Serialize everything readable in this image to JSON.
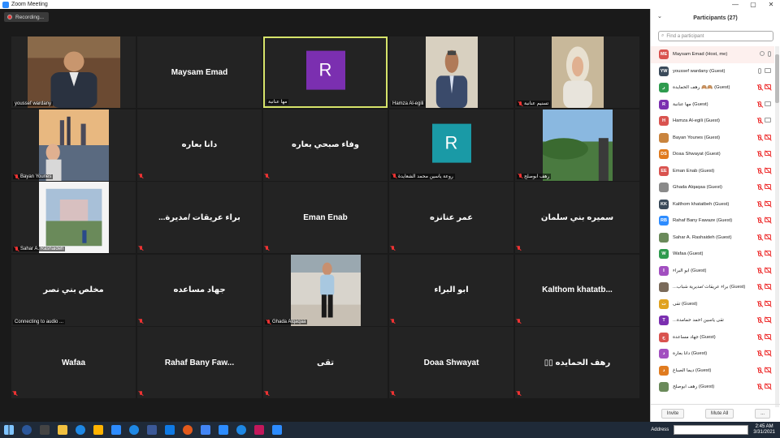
{
  "window": {
    "title": "Zoom Meeting",
    "controls": [
      "—",
      "▢",
      "✕"
    ]
  },
  "recording": {
    "label": "Recording..."
  },
  "tiles": [
    {
      "label": "youssef wardany",
      "kind": "photo",
      "photo": "man-office",
      "muted": false
    },
    {
      "label": "Maysam Emad",
      "kind": "name",
      "muted": false
    },
    {
      "label": "مها عنانبة",
      "kind": "avatar",
      "avatar_letter": "R",
      "avatar_color": "#7b2fb0",
      "active": true,
      "muted": false
    },
    {
      "label": "Hamza Al-egili",
      "kind": "photo",
      "photo": "man-suit",
      "muted": false
    },
    {
      "label": "تسنيم عنانبة",
      "kind": "photo",
      "photo": "woman-hijab",
      "muted": true
    },
    {
      "label": "Bayan Younes",
      "kind": "photo",
      "photo": "city-lake",
      "muted": true
    },
    {
      "label": "دانا بعاره",
      "kind": "name",
      "muted": true
    },
    {
      "label": "وفاء صبحي بعاره",
      "kind": "name",
      "muted": true
    },
    {
      "label": "روعة ياسين محمد الشعايدة",
      "kind": "avatar",
      "avatar_letter": "R",
      "avatar_color": "#1a9aa6",
      "muted": true
    },
    {
      "label": "رهف ابوصلح",
      "kind": "photo",
      "photo": "landscape",
      "muted": true
    },
    {
      "label": "Sahar A. Rashaideh",
      "kind": "photo",
      "photo": "castle",
      "muted": true
    },
    {
      "label": "...براء عريقات /مديرة",
      "kind": "name",
      "muted": true
    },
    {
      "label": "Eman Enab",
      "kind": "name",
      "muted": true
    },
    {
      "label": "عمر عنانزه",
      "kind": "name",
      "muted": true
    },
    {
      "label": "سميره بني سلمان",
      "kind": "name",
      "muted": true
    },
    {
      "label": "مخلص بني نصر",
      "kind": "name",
      "status": "Connecting to audio ...",
      "muted": false
    },
    {
      "label": "جهاد مساعده",
      "kind": "name",
      "muted": true
    },
    {
      "label": "Ghada Alqaqaa",
      "kind": "photo",
      "photo": "girl-stairs",
      "muted": true
    },
    {
      "label": "ابو البراء",
      "kind": "name",
      "muted": true
    },
    {
      "label": "Kalthom khatatb...",
      "kind": "name",
      "muted": true
    },
    {
      "label": "Wafaa",
      "kind": "name",
      "muted": true
    },
    {
      "label": "Rahaf Bany Faw...",
      "kind": "name",
      "muted": true
    },
    {
      "label": "تقى",
      "kind": "name",
      "muted": true
    },
    {
      "label": "Doaa Shwayat",
      "kind": "name",
      "muted": true
    },
    {
      "label": "▯▯ رهف الحمايده",
      "kind": "name",
      "muted": true
    }
  ],
  "panel": {
    "title": "Participants (27)",
    "search_placeholder": "Find a participant",
    "participants": [
      {
        "name": "Maysam Emad (Host, me)",
        "initials": "ME",
        "color": "#d9534f",
        "mic": "on",
        "cam": "none",
        "hand": true
      },
      {
        "name": "youssef wardany (Guest)",
        "initials": "YW",
        "color": "#3a4a5a",
        "mic": "on",
        "cam": "on"
      },
      {
        "name": "رهف الحمايده 🙈🙈 (Guest)",
        "initials": "ر",
        "color": "#2e9b4e",
        "mic": "red",
        "cam": "red"
      },
      {
        "name": "مها عنانبة (Guest)",
        "initials": "R",
        "color": "#7b2fb0",
        "mic": "red",
        "cam": "on"
      },
      {
        "name": "Hamza Al-egili (Guest)",
        "initials": "H",
        "color": "#d9534f",
        "mic": "red",
        "cam": "on"
      },
      {
        "name": "Bayan Younes (Guest)",
        "initials": "",
        "color": "#c9843e",
        "mic": "red",
        "cam": "red"
      },
      {
        "name": "Doaa Shwayat (Guest)",
        "initials": "DS",
        "color": "#e07b1f",
        "mic": "red",
        "cam": "red"
      },
      {
        "name": "Eman Enab (Guest)",
        "initials": "EE",
        "color": "#d9534f",
        "mic": "red",
        "cam": "red"
      },
      {
        "name": "Ghada Alqaqaa (Guest)",
        "initials": "",
        "color": "#8a8a8a",
        "mic": "red",
        "cam": "red"
      },
      {
        "name": "Kalthom khatatbeh (Guest)",
        "initials": "KK",
        "color": "#3a4a5a",
        "mic": "red",
        "cam": "red"
      },
      {
        "name": "Rahaf Bany Fawaze (Guest)",
        "initials": "RB",
        "color": "#2d8cff",
        "mic": "red",
        "cam": "red"
      },
      {
        "name": "Sahar A. Rashaideh (Guest)",
        "initials": "",
        "color": "#6a8a5a",
        "mic": "red",
        "cam": "red"
      },
      {
        "name": "Wafaa (Guest)",
        "initials": "W",
        "color": "#2e9b4e",
        "mic": "red",
        "cam": "red"
      },
      {
        "name": "ابو البراء (Guest)",
        "initials": "ا",
        "color": "#a24fc0",
        "mic": "red",
        "cam": "red"
      },
      {
        "name": "...براء عريقات /مديرية شباب (Guest)",
        "initials": "",
        "color": "#7a6a5a",
        "mic": "red",
        "cam": "red"
      },
      {
        "name": "تقى (Guest)",
        "initials": "ت",
        "color": "#e0a21f",
        "mic": "red",
        "cam": "red"
      },
      {
        "name": "...تقى ياسين احمد حمامده",
        "initials": "T",
        "color": "#7b2fb0",
        "mic": "red",
        "cam": "red"
      },
      {
        "name": "جهاد مساعده (Guest)",
        "initials": "ج",
        "color": "#d9534f",
        "mic": "red",
        "cam": "red"
      },
      {
        "name": "دانا بعاره (Guest)",
        "initials": "د",
        "color": "#a24fc0",
        "mic": "red",
        "cam": "red"
      },
      {
        "name": "ديما الصباغ (Guest)",
        "initials": "د",
        "color": "#e07b1f",
        "mic": "red",
        "cam": "red"
      },
      {
        "name": "رهف ابوصلح (Guest)",
        "initials": "",
        "color": "#6a8a5a",
        "mic": "red",
        "cam": "red"
      }
    ],
    "invite_label": "Invite",
    "mute_all_label": "Mute All",
    "more_label": "..."
  },
  "taskbar": {
    "address_label": "Address",
    "time": "2:45 AM",
    "date": "3/31/2021",
    "icon_colors": [
      "#2b579a",
      "#444",
      "#f0c040",
      "#1e88e5",
      "#ffb300",
      "#2d8cff",
      "#1e88e5",
      "#3b5998",
      "#0f7ae5",
      "#e25a1c",
      "#4285f4",
      "#2d8cff",
      "#1e88e5",
      "#c2185b",
      "#2d8cff"
    ]
  }
}
